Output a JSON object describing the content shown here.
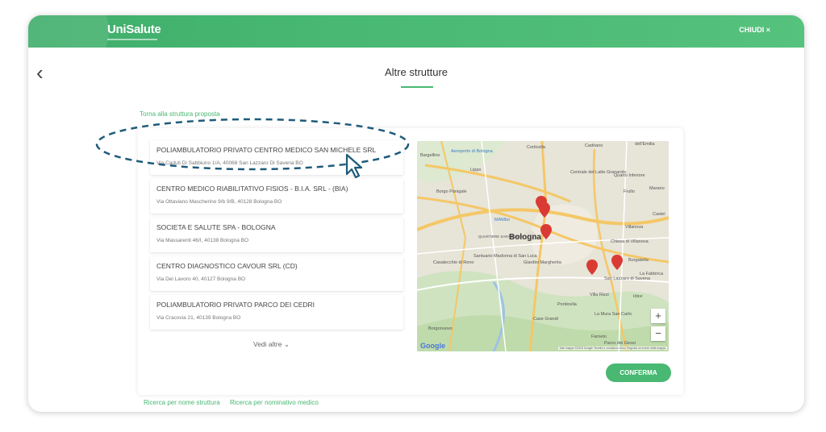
{
  "header": {
    "logo": "UniSalute",
    "close_label": "CHIUDI ×"
  },
  "page": {
    "title": "Altre strutture",
    "back_link": "Torna alla struttura proposta"
  },
  "structures": [
    {
      "name": "POLIAMBULATORIO PRIVATO CENTRO MEDICO SAN MICHELE SRL",
      "address": "Via Caduti Di Sabbiuno 1/A, 40068 San Lazzaro Di Savena BO"
    },
    {
      "name": "CENTRO MEDICO RIABILITATIVO FISIOS - B.I.A. SRL - (BIA)",
      "address": "Via Ottaviano Mascherino 9/b 9/B, 40128 Bologna BO"
    },
    {
      "name": "SOCIETA E SALUTE SPA - BOLOGNA",
      "address": "Via Massarenti 46/I, 40138 Bologna BO"
    },
    {
      "name": "CENTRO DIAGNOSTICO CAVOUR SRL (CD)",
      "address": "Via Del Lavoro 40, 40127 Bologna BO"
    },
    {
      "name": "POLIAMBULATORIO PRIVATO PARCO DEI CEDRI",
      "address": "Via Cracovia 21, 40139 Bologna BO"
    }
  ],
  "see_more": "Vedi altre",
  "map": {
    "labels": {
      "bargellino": "Bargellino",
      "aeroporto": "Aeroporto di Bologna",
      "lippo": "Lippo",
      "corticella": "Corticella",
      "cadriano": "Cadriano",
      "dellemilia": "dell'Emilia",
      "centrale": "Centrale del Latte Granarolo",
      "quarto": "Quarto Inferiore",
      "frullo": "Frullo",
      "marano": "Marano",
      "borgo": "Borgo Panigale",
      "mambo": "MAMbo",
      "bologna": "Bologna",
      "villanova": "Villanova",
      "chiesa": "Chiesa di Villanova",
      "quadrilatero": "QUARTIERE SARAGOZZA",
      "madonna": "Santuario Madonna di San Luca",
      "casalecchio": "Casalecchio di Reno",
      "giardini": "Giardini Margherita",
      "borgatella": "Borgatella",
      "fabbrica": "La Fabbrica",
      "sanlazzaro": "San Lazzaro di Savena",
      "idice": "Idice",
      "villarizzi": "Villa Rizzi",
      "ponticella": "Ponticella",
      "castegrandi": "Case Grandi",
      "lamarea": "La Mura San Carlo",
      "farneto": "Farneto",
      "borgonuovo": "Borgonuovo",
      "castel": "Castel",
      "parco": "Parco dei Gessi"
    },
    "google": "Google",
    "attribution": "Dati mappa ©2018 Google   Termini e condizioni d'uso   Segnala un errore nella mappa",
    "zoom_in": "+",
    "zoom_out": "−"
  },
  "confirm_label": "CONFERMA",
  "footer": {
    "search_by_name": "Ricerca per nome struttura",
    "search_by_doctor": "Ricerca per nominativo medico"
  },
  "colors": {
    "brand_green": "#48b872",
    "marker_red": "#d93b34"
  }
}
